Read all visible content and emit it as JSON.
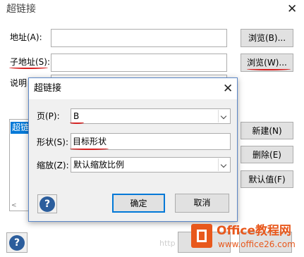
{
  "outer": {
    "title": "超链接",
    "labels": {
      "address": "地址(A):",
      "sub_address": "子地址(S):",
      "description": "说明"
    },
    "buttons": {
      "browse_address": "浏览(B)...",
      "browse_sub": "浏览(W)...",
      "new": "新建(N)",
      "delete": "删除(E)",
      "default": "默认值(F)"
    },
    "list_first_item": "超链",
    "help": "?"
  },
  "inner": {
    "title": "超链接",
    "page_label": "页(P):",
    "page_value": "B",
    "shape_label": "形状(S):",
    "shape_value": "目标形状",
    "zoom_label": "缩放(Z):",
    "zoom_value": "默认缩放比例",
    "ok": "确定",
    "cancel": "取消",
    "help": "?"
  },
  "watermark": {
    "url": "http",
    "logo": "Office教程网",
    "site": "www.office26.com"
  },
  "colors": {
    "annotation_red": "#d71f1f",
    "brand_orange": "#e8581c",
    "dialog_border": "#5b86c6"
  }
}
